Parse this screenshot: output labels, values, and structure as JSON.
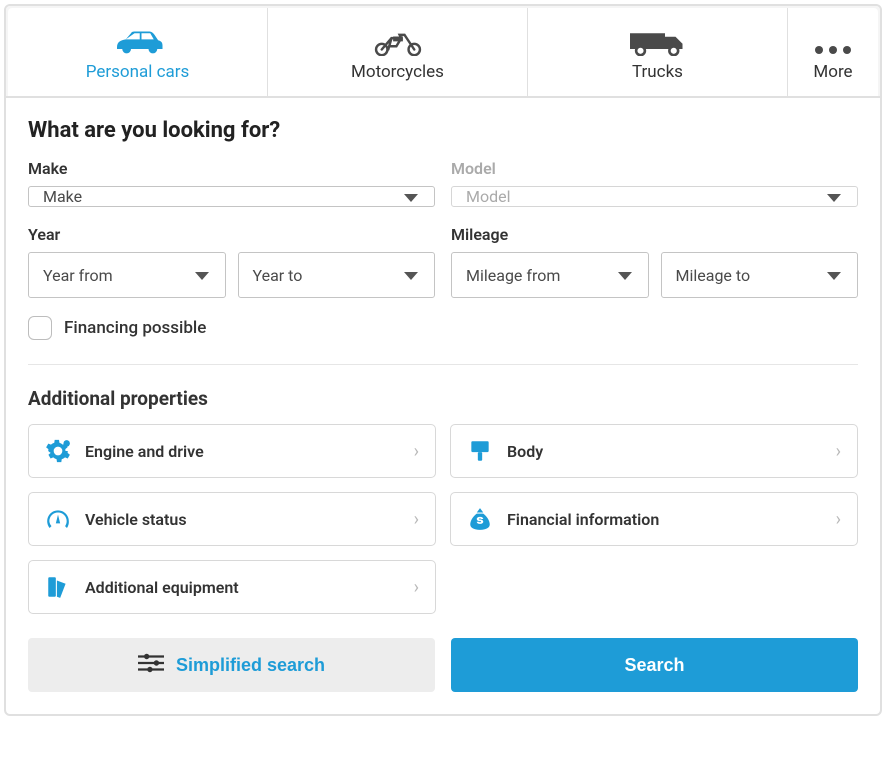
{
  "tabs": {
    "items": [
      {
        "label": "Personal cars"
      },
      {
        "label": "Motorcycles"
      },
      {
        "label": "Trucks"
      },
      {
        "label": "More"
      }
    ]
  },
  "search": {
    "title": "What are you looking for?",
    "make_label": "Make",
    "make_placeholder": "Make",
    "model_label": "Model",
    "model_placeholder": "Model",
    "year_label": "Year",
    "year_from_placeholder": "Year from",
    "year_to_placeholder": "Year to",
    "mileage_label": "Mileage",
    "mileage_from_placeholder": "Mileage from",
    "mileage_to_placeholder": "Mileage to",
    "financing_label": "Financing possible"
  },
  "additional": {
    "title": "Additional properties",
    "items": {
      "engine": "Engine and drive",
      "body": "Body",
      "status": "Vehicle status",
      "finance": "Financial information",
      "equipment": "Additional equipment"
    }
  },
  "actions": {
    "simplified": "Simplified search",
    "search": "Search"
  }
}
